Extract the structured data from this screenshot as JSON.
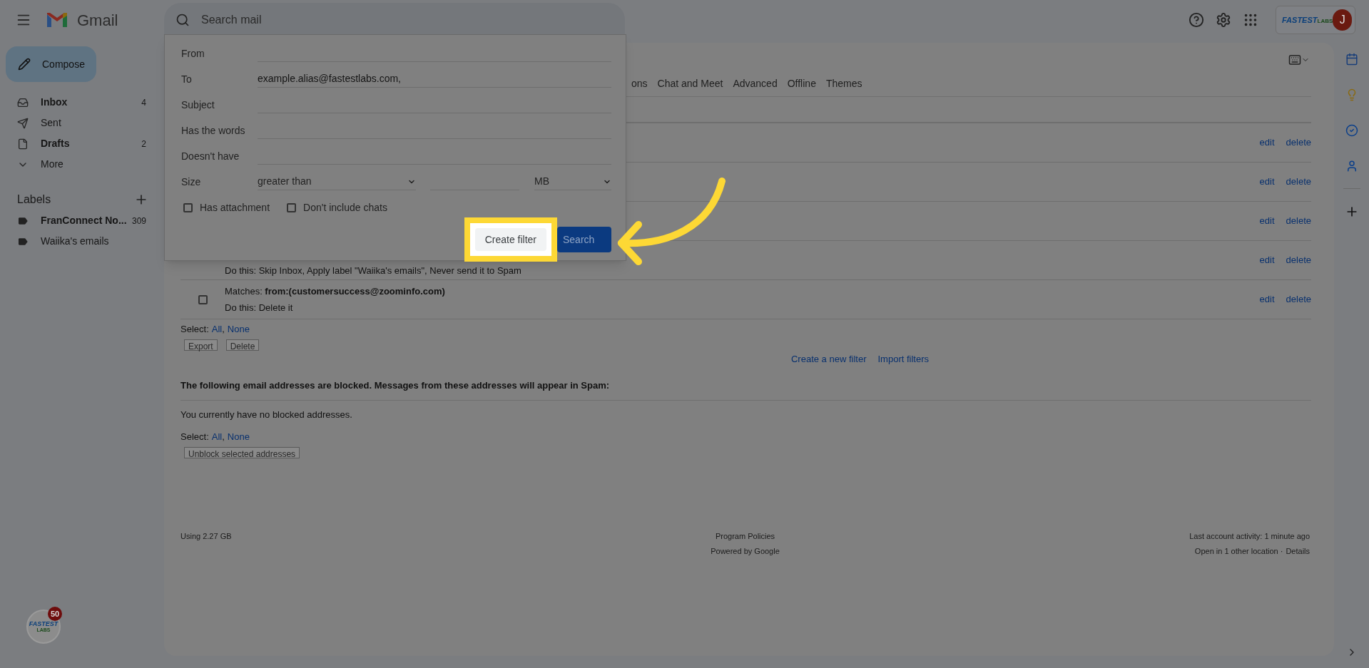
{
  "header": {
    "app_name": "Gmail",
    "search": {
      "placeholder": "Search mail"
    },
    "brand": {
      "name": "FASTEST",
      "suffix": "LABS"
    },
    "avatar": "J"
  },
  "sidebar": {
    "compose": "Compose",
    "items": [
      {
        "kind": "inbox",
        "label": "Inbox",
        "count": "4",
        "bold": true
      },
      {
        "kind": "sent",
        "label": "Sent",
        "bold": false
      },
      {
        "kind": "drafts",
        "label": "Drafts",
        "count": "2",
        "bold": true
      },
      {
        "kind": "more",
        "label": "More",
        "bold": false
      }
    ],
    "labels_title": "Labels",
    "labels": [
      {
        "label": "FranConnect No...",
        "count": "309",
        "bold": true
      },
      {
        "label": "Waiika's emails",
        "bold": false
      }
    ]
  },
  "search_panel": {
    "fields": [
      {
        "label": "From"
      },
      {
        "label": "To",
        "value": "example.alias@fastestlabs.com,"
      },
      {
        "label": "Subject"
      },
      {
        "label": "Has the words"
      },
      {
        "label": "Doesn't have"
      }
    ],
    "size": {
      "label": "Size",
      "comparator": "greater than",
      "unit": "MB"
    },
    "checkboxes": [
      {
        "label": "Has attachment",
        "checked": false
      },
      {
        "label": "Don't include chats",
        "checked": false
      }
    ],
    "create_filter": "Create filter",
    "search": "Search"
  },
  "settings": {
    "tabs": [
      {
        "label": "ons",
        "selected": false
      },
      {
        "label": "Chat and Meet",
        "selected": false
      },
      {
        "label": "Advanced",
        "selected": false
      },
      {
        "label": "Offline",
        "selected": false
      },
      {
        "label": "Themes",
        "selected": false
      }
    ],
    "filters": [
      {
        "edit": "edit",
        "delete": "delete"
      },
      {
        "edit": "edit",
        "delete": "delete"
      },
      {
        "edit": "edit",
        "delete": "delete"
      },
      {
        "action": "Do this: Skip Inbox, Apply label \"Waiika's emails\", Never send it to Spam",
        "edit": "edit",
        "delete": "delete"
      },
      {
        "matches": "Matches: **from:(customersuccess@zoominfo.com)**",
        "action": "Do this: Delete it",
        "checked": false,
        "edit": "edit",
        "delete": "delete"
      }
    ],
    "select": {
      "label": "Select:",
      "options": [
        "All",
        "None"
      ],
      "separator": ","
    },
    "filter_buttons": [
      "Export",
      "Delete"
    ],
    "links": [
      "Create a new filter",
      "Import filters"
    ],
    "blocked_heading": "The following email addresses are blocked. Messages from these addresses will appear in Spam:",
    "blocked_note": "You currently have no blocked addresses.",
    "blocked_select": {
      "label": "Select:",
      "options": [
        "All",
        "None"
      ],
      "separator": ","
    },
    "unblock": "Unblock selected addresses"
  },
  "footer": {
    "storage": "Using 2.27 GB",
    "center": [
      "Program Policies",
      "Powered by Google"
    ],
    "activity": "Last account activity: 1 minute ago",
    "other": "Open in 1 other location ·",
    "details": "Details"
  },
  "floating_badge": {
    "brand": "FASTEST",
    "suffix": "LABS",
    "count": "50"
  }
}
